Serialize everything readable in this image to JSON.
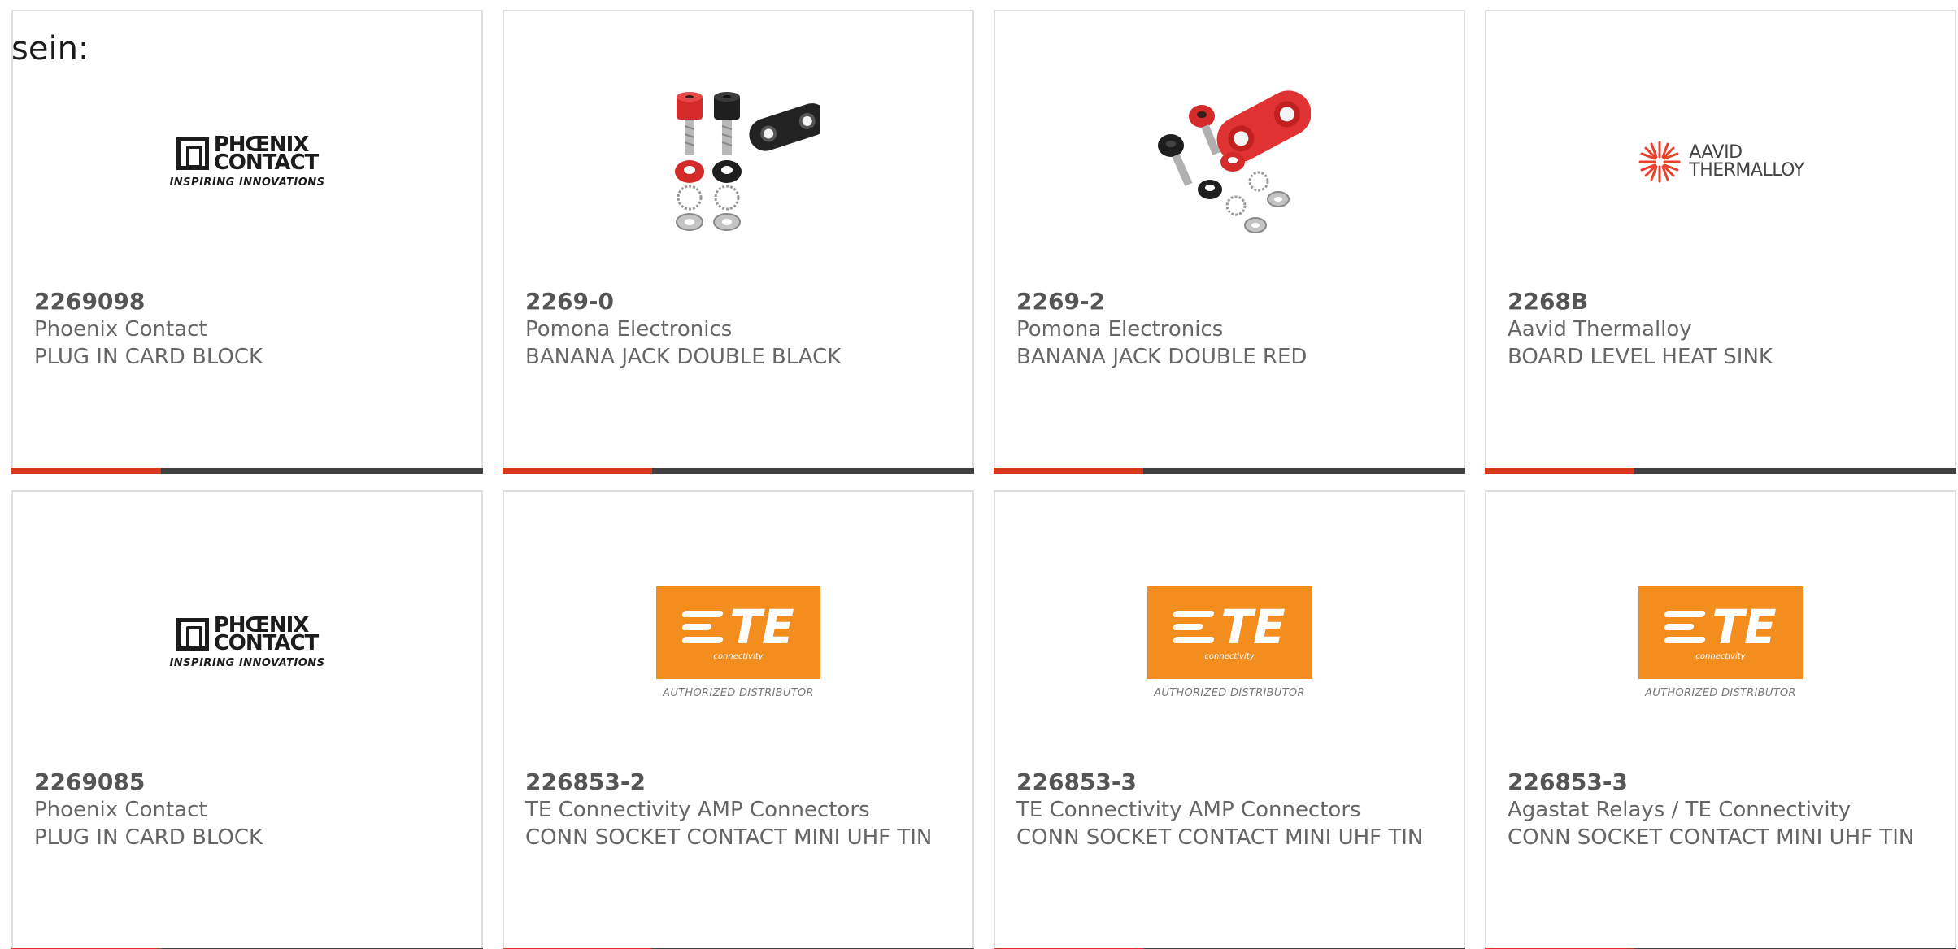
{
  "intro_text": "sein:",
  "products": [
    {
      "part_number": "2269098",
      "manufacturer": "Phoenix Contact",
      "description": "PLUG IN CARD BLOCK",
      "image": "phoenix-contact-logo",
      "logo_text": {
        "line1": "PHŒNIX",
        "line2": "CONTACT",
        "tagline": "INSPIRING INNOVATIONS"
      }
    },
    {
      "part_number": "2269-0",
      "manufacturer": "Pomona Electronics",
      "description": "BANANA JACK DOUBLE BLACK",
      "image": "banana-jack-black-photo"
    },
    {
      "part_number": "2269-2",
      "manufacturer": "Pomona Electronics",
      "description": "BANANA JACK DOUBLE RED",
      "image": "banana-jack-red-photo"
    },
    {
      "part_number": "2268B",
      "manufacturer": "Aavid Thermalloy",
      "description": "BOARD LEVEL HEAT SINK",
      "image": "aavid-thermalloy-logo",
      "logo_text": {
        "line1": "AAVID",
        "line2": "THERMALLOY"
      }
    },
    {
      "part_number": "2269085",
      "manufacturer": "Phoenix Contact",
      "description": "PLUG IN CARD BLOCK",
      "image": "phoenix-contact-logo",
      "logo_text": {
        "line1": "PHŒNIX",
        "line2": "CONTACT",
        "tagline": "INSPIRING INNOVATIONS"
      }
    },
    {
      "part_number": "226853-2",
      "manufacturer": "TE Connectivity AMP Connectors",
      "description": "CONN SOCKET CONTACT MINI UHF TIN",
      "image": "te-connectivity-logo",
      "logo_text": {
        "brand": "TE",
        "sub": "connectivity",
        "tagline": "AUTHORIZED DISTRIBUTOR"
      }
    },
    {
      "part_number": "226853-3",
      "manufacturer": "TE Connectivity AMP Connectors",
      "description": "CONN SOCKET CONTACT MINI UHF TIN",
      "image": "te-connectivity-logo",
      "logo_text": {
        "brand": "TE",
        "sub": "connectivity",
        "tagline": "AUTHORIZED DISTRIBUTOR"
      }
    },
    {
      "part_number": "226853-3",
      "manufacturer": "Agastat Relays / TE Connectivity",
      "description": "CONN SOCKET CONTACT MINI UHF TIN",
      "image": "te-connectivity-logo",
      "logo_text": {
        "brand": "TE",
        "sub": "connectivity",
        "tagline": "AUTHORIZED DISTRIBUTOR"
      }
    }
  ],
  "colors": {
    "accent": "#d9381e",
    "bar": "#404040",
    "te_orange": "#f28d1e",
    "aavid_red": "#e8402a",
    "card_border": "#dedede"
  }
}
